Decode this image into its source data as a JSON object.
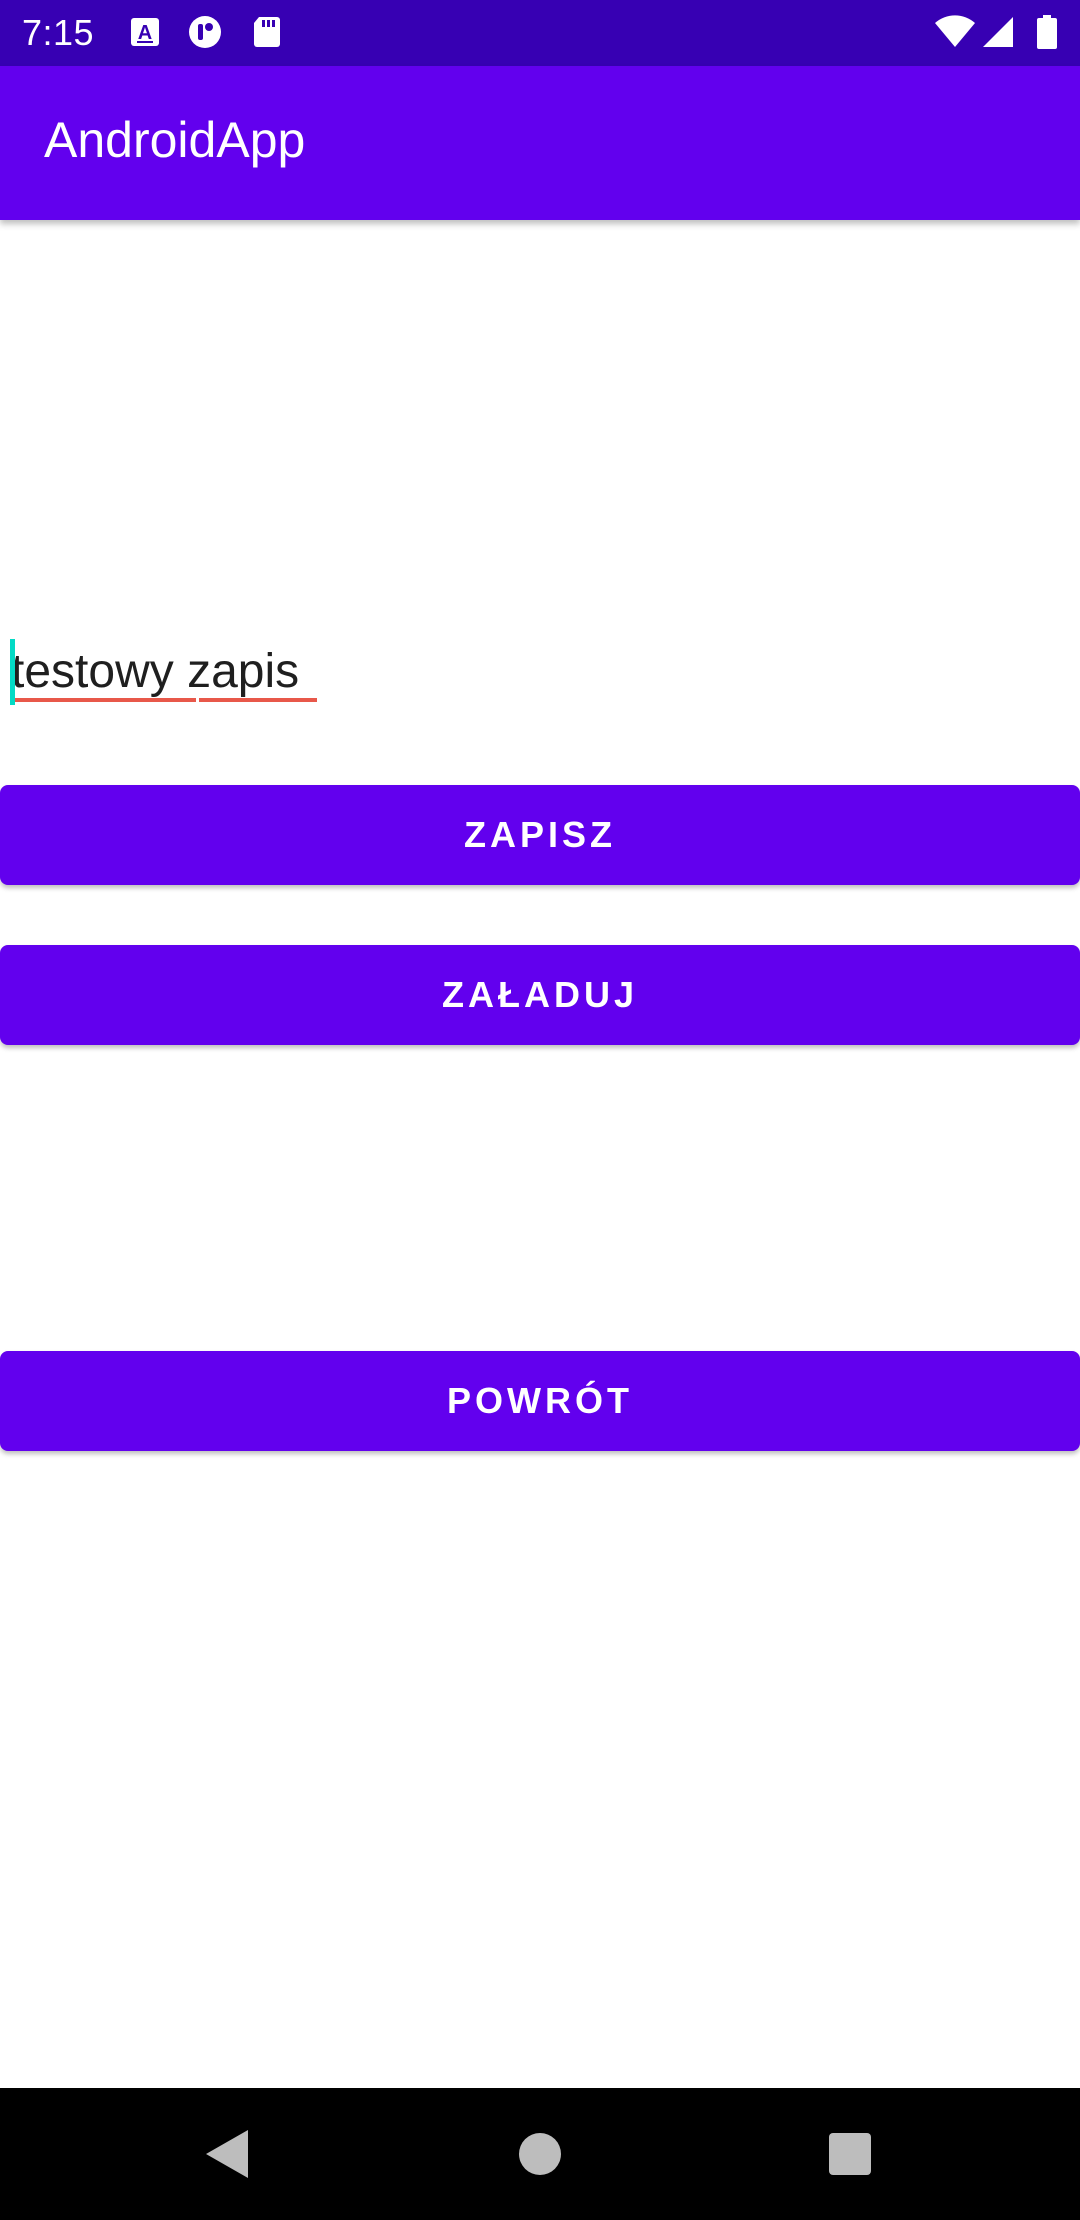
{
  "status_bar": {
    "time": "7:15",
    "background": "#3700b3",
    "left_icons": [
      "keyboard-icon",
      "notification-app-icon",
      "sd-card-icon"
    ],
    "right_icons": [
      "wifi-icon",
      "signal-icon",
      "battery-icon"
    ]
  },
  "app_bar": {
    "title": "AndroidApp",
    "background": "#6200ee"
  },
  "edit_text": {
    "value": "testowy zapis",
    "accent_color": "#03dac5"
  },
  "buttons": {
    "save_label": "ZAPISZ",
    "load_label": "ZAŁADUJ",
    "back_label": "POWRÓT",
    "color": "#6200ee"
  },
  "nav_bar": {
    "icons": [
      "back-icon",
      "home-icon",
      "recents-icon"
    ]
  }
}
